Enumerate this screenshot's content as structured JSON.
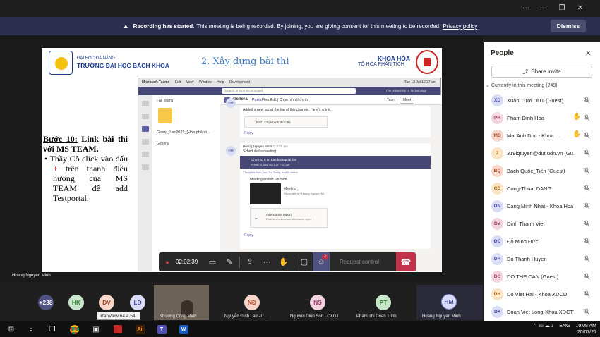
{
  "window": {
    "minimize": "—",
    "maximize": "⧉",
    "restore": "❐",
    "close": "✕"
  },
  "banner": {
    "bold": "Recording has started.",
    "text": "This meeting is being recorded. By joining, you are giving consent for this meeting to be recorded.",
    "link": "Privacy policy",
    "dismiss": "Dismiss"
  },
  "slide": {
    "uni_line1": "ĐẠI HỌC ĐÀ NẴNG",
    "uni_line2": "TRƯỜNG ĐẠI HỌC BÁCH KHOA",
    "title": "2. Xây dựng bài thi",
    "dept_line1": "KHOA HÓA",
    "dept_line2": "TỔ HÓA PHÂN TÍCH",
    "step_label": "Bước 10:",
    "step_text": "Link bài thi với MS TEAM.",
    "bullet_a": "Thầy Cô click vào dấu",
    "plus": "+",
    "bullet_b": "trên thanh điều hướng của MS TEAM để add Testportal."
  },
  "teams": {
    "app": "Microsoft Teams",
    "menu": [
      "Edit",
      "View",
      "Window",
      "Help",
      "Development"
    ],
    "search_placeholder": "Search or type a command",
    "org": "The University of Technology",
    "back": "‹ All teams",
    "team_name": "Group_Lec2021_[Hóa phân t...",
    "channel_general": "General",
    "header_channel": "General",
    "tabs": [
      "Posts",
      "Files",
      "Edit | Chọn hình thức thi"
    ],
    "team_btn": "Team",
    "meet_btn": "Meet",
    "msg1_line": "Added a new tab at the top of this channel. Here's a link.",
    "msg1_card": "Edit | Chọn hình thức thi",
    "reply": "Reply",
    "msg2_author": "Hoang Nguyen Minh",
    "msg2_time": "6/7 8:55 am",
    "msg2_text": "Scheduled a meeting",
    "meeting_title": "Chương 9 ôn Lan bài tập tại lớp",
    "meeting_when": "Friday, 9 July 2021 @ 7:00 am",
    "meeting_replies": "27 replies from you, Tu, Trang, and 6 others",
    "meeting_ended": "Meeting ended: 2h 59m",
    "rec_title": "Meeting",
    "rec_by": "Recorded by: Hoang Nguyen Mi",
    "attendance": "Attendance report",
    "attendance_sub": "Click here to download attendance report",
    "reply2": "Reply",
    "avatar_hm": "HM",
    "time": "Tue 13 Jul  10:37 am"
  },
  "controls": {
    "timer": "02:02:39",
    "request": "Request control",
    "badge": "2"
  },
  "stage": {
    "presenter": "Hoang Nguyen Minh"
  },
  "strip": {
    "overflow": "+238",
    "tiles": [
      {
        "initials": "HK",
        "color": "#c8e6c9",
        "fg": "#2e7d32"
      },
      {
        "initials": "DV",
        "color": "#f8d6c9",
        "fg": "#a5482c"
      },
      {
        "initials": "LD",
        "color": "#d9dcf7",
        "fg": "#4a4f9e"
      }
    ],
    "video_name": "Khương Công Minh",
    "people": [
      {
        "initials": "NĐ",
        "name": "Nguyễn Đình Lam-Tr...",
        "color": "#f8d6c9",
        "fg": "#a5482c"
      },
      {
        "initials": "NS",
        "name": "Nguyen Dinh Son - CXGT",
        "color": "#f3d3e0",
        "fg": "#9a3b63"
      },
      {
        "initials": "PT",
        "name": "Pham Thi Doan Trinh",
        "color": "#c8e6c9",
        "fg": "#2e7d32"
      },
      {
        "initials": "HM",
        "name": "Hoang Nguyen Minh",
        "color": "#d9dcf7",
        "fg": "#4a4f9e"
      }
    ]
  },
  "tooltip": "IrfanView 64 4.54",
  "people_panel": {
    "title": "People",
    "share_invite": "Share invite",
    "current": "Currently in this meeting (249)",
    "rows": [
      {
        "initials": "XD",
        "name": "Xuân Tươi DUT (Guest)",
        "color": "#d9dcf7",
        "fg": "#4a4f9e",
        "hand": false
      },
      {
        "initials": "PH",
        "name": "Pham Dinh Hoa",
        "color": "#f3d3e0",
        "fg": "#9a3b63",
        "hand": true
      },
      {
        "initials": "MD",
        "name": "Mai Anh Duc - Khoa ...",
        "color": "#f8d6c9",
        "fg": "#a5482c",
        "hand": true
      },
      {
        "initials": "3",
        "name": "319lqtuyen@dut.udn.vn (Gu...",
        "color": "#fbe3c4",
        "fg": "#a06010",
        "hand": false
      },
      {
        "initials": "BQ",
        "name": "Bach Quốc_Tiến (Guest)",
        "color": "#f8d6c9",
        "fg": "#a5482c",
        "hand": false
      },
      {
        "initials": "CD",
        "name": "Cong-Thuat DANG",
        "color": "#fbe3c4",
        "fg": "#a06010",
        "hand": false
      },
      {
        "initials": "DN",
        "name": "Dang Minh Nhat - Khoa Hoa",
        "color": "#d9dcf7",
        "fg": "#4a4f9e",
        "hand": false
      },
      {
        "initials": "DV",
        "name": "Dinh Thanh Viet",
        "color": "#f3d3e0",
        "fg": "#9a3b63",
        "hand": false
      },
      {
        "initials": "ĐĐ",
        "name": "Đỗ Minh Đức",
        "color": "#d9dcf7",
        "fg": "#4a4f9e",
        "hand": false
      },
      {
        "initials": "DH",
        "name": "Do Thanh Huyen",
        "color": "#d9dcf7",
        "fg": "#4a4f9e",
        "hand": false
      },
      {
        "initials": "DC",
        "name": "DO THE CAN (Guest)",
        "color": "#f3d3e0",
        "fg": "#9a3b63",
        "hand": false
      },
      {
        "initials": "DH",
        "name": "Do Viet Hai - Khoa XDCD",
        "color": "#fbe3c4",
        "fg": "#a06010",
        "hand": false
      },
      {
        "initials": "DX",
        "name": "Doan Viet Long-Khoa XDCTT",
        "color": "#d9dcf7",
        "fg": "#4a4f9e",
        "hand": false
      }
    ]
  },
  "taskbar": {
    "lang": "ENG",
    "time": "10:08 AM",
    "date": "20/07/21"
  }
}
